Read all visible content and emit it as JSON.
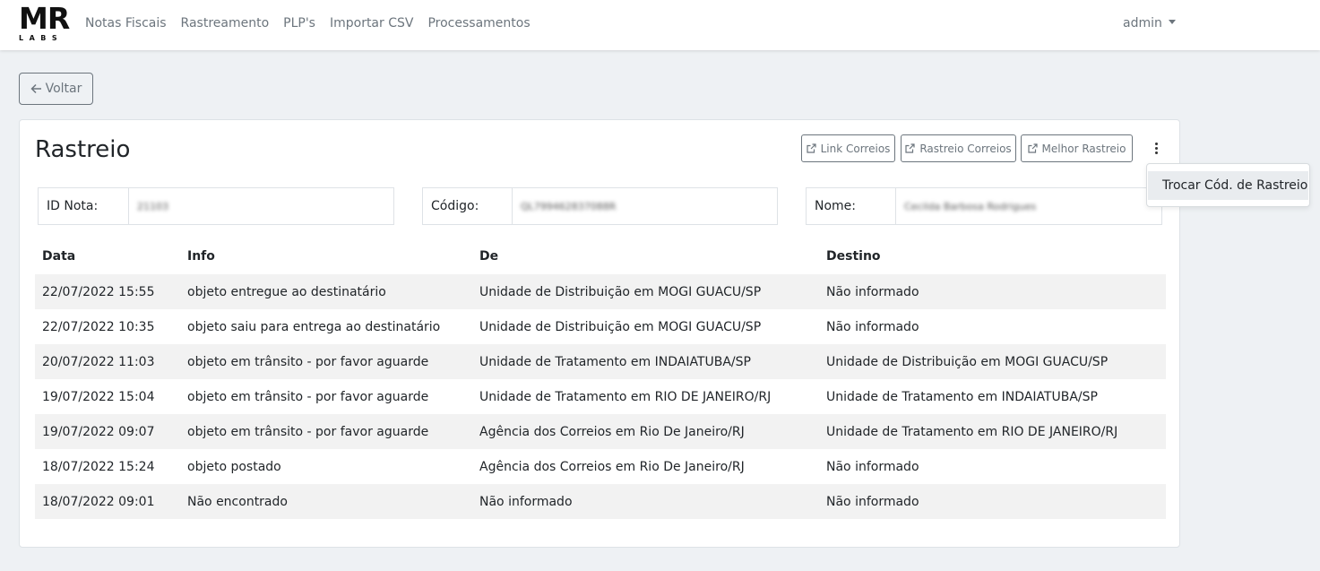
{
  "brand": {
    "logo_main": "MR",
    "logo_sub": "LABS"
  },
  "nav": {
    "links": [
      "Notas Fiscais",
      "Rastreamento",
      "PLP's",
      "Importar CSV",
      "Processamentos"
    ],
    "user": "admin"
  },
  "back_button": {
    "label": "Voltar",
    "icon": "arrow-left-icon"
  },
  "card": {
    "title": "Rastreio",
    "actions": [
      {
        "label": "Link Correios",
        "icon": "external-link-icon"
      },
      {
        "label": "Rastreio Correios",
        "icon": "external-link-icon"
      },
      {
        "label": "Melhor Rastreio",
        "icon": "external-link-icon"
      }
    ],
    "more_icon": "kebab-vertical-icon",
    "dropdown": {
      "item": "Trocar Cód. de Rastreio"
    },
    "fields": [
      {
        "label": "ID Nota:",
        "value": "21103"
      },
      {
        "label": "Código:",
        "value": "QL799462837088R"
      },
      {
        "label": "Nome:",
        "value": "Cecilda Barbosa Rodrigues"
      }
    ],
    "table": {
      "headers": [
        "Data",
        "Info",
        "De",
        "Destino"
      ],
      "rows": [
        [
          "22/07/2022 15:55",
          "objeto entregue ao destinatário",
          "Unidade de Distribuição em MOGI GUACU/SP",
          "Não informado"
        ],
        [
          "22/07/2022 10:35",
          "objeto saiu para entrega ao destinatário",
          "Unidade de Distribuição em MOGI GUACU/SP",
          "Não informado"
        ],
        [
          "20/07/2022 11:03",
          "objeto em trânsito - por favor aguarde",
          "Unidade de Tratamento em INDAIATUBA/SP",
          "Unidade de Distribuição em MOGI GUACU/SP"
        ],
        [
          "19/07/2022 15:04",
          "objeto em trânsito - por favor aguarde",
          "Unidade de Tratamento em RIO DE JANEIRO/RJ",
          "Unidade de Tratamento em INDAIATUBA/SP"
        ],
        [
          "19/07/2022 09:07",
          "objeto em trânsito - por favor aguarde",
          "Agência dos Correios em Rio De Janeiro/RJ",
          "Unidade de Tratamento em RIO DE JANEIRO/RJ"
        ],
        [
          "18/07/2022 15:24",
          "objeto postado",
          "Agência dos Correios em Rio De Janeiro/RJ",
          "Não informado"
        ],
        [
          "18/07/2022 09:01",
          "Não encontrado",
          "Não informado",
          "Não informado"
        ]
      ]
    }
  }
}
